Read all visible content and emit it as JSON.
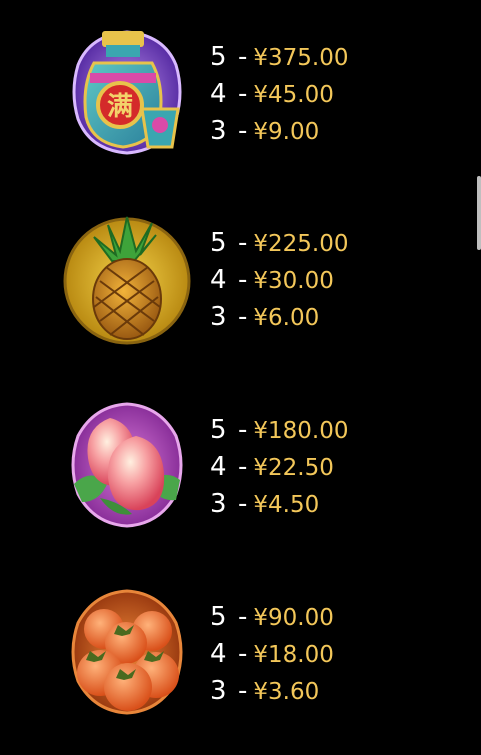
{
  "colors": {
    "count_text": "#ffffff",
    "amount_text": "#f3c75a",
    "background": "#000000"
  },
  "symbols": [
    {
      "icon": "vase-icon",
      "badge_text": "满",
      "payouts": [
        {
          "count": "5",
          "separator": "-",
          "amount": "¥375.00"
        },
        {
          "count": "4",
          "separator": "-",
          "amount": "¥45.00"
        },
        {
          "count": "3",
          "separator": "-",
          "amount": "¥9.00"
        }
      ]
    },
    {
      "icon": "pineapple-icon",
      "payouts": [
        {
          "count": "5",
          "separator": "-",
          "amount": "¥225.00"
        },
        {
          "count": "4",
          "separator": "-",
          "amount": "¥30.00"
        },
        {
          "count": "3",
          "separator": "-",
          "amount": "¥6.00"
        }
      ]
    },
    {
      "icon": "peach-icon",
      "payouts": [
        {
          "count": "5",
          "separator": "-",
          "amount": "¥180.00"
        },
        {
          "count": "4",
          "separator": "-",
          "amount": "¥22.50"
        },
        {
          "count": "3",
          "separator": "-",
          "amount": "¥4.50"
        }
      ]
    },
    {
      "icon": "persimmon-icon",
      "payouts": [
        {
          "count": "5",
          "separator": "-",
          "amount": "¥90.00"
        },
        {
          "count": "4",
          "separator": "-",
          "amount": "¥18.00"
        },
        {
          "count": "3",
          "separator": "-",
          "amount": "¥3.60"
        }
      ]
    }
  ]
}
